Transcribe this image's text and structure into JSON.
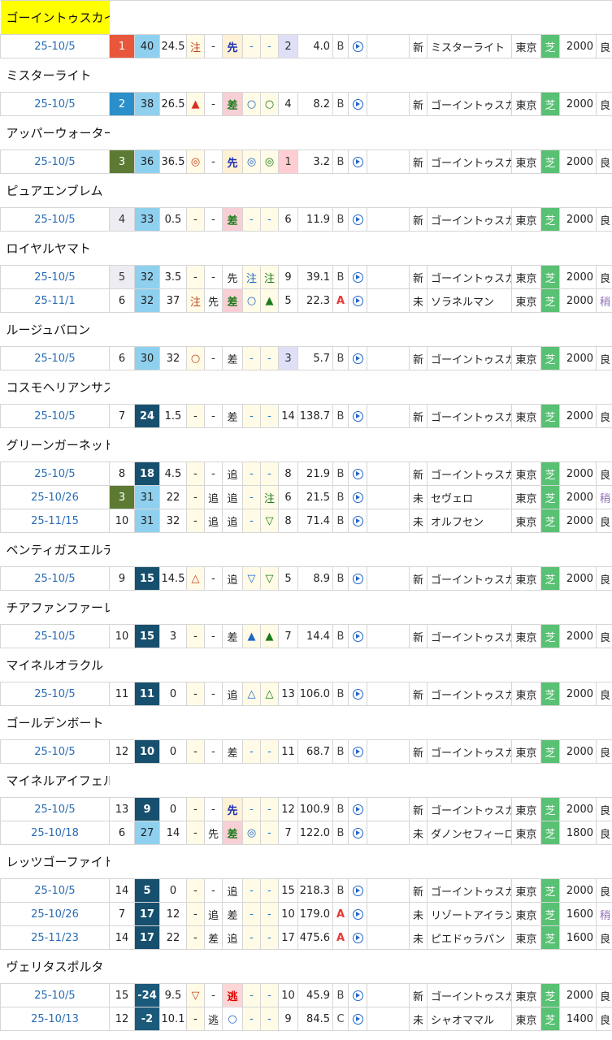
{
  "horses": [
    {
      "name": "ゴーイントゥスカイ",
      "highlight": true,
      "races": [
        {
          "date": "25-10/5",
          "rank": "1",
          "rankClass": "rk1",
          "score": "40",
          "scoreClass": "sc",
          "v1": "24.5",
          "m1": "注",
          "m1c": "org",
          "m2": "-",
          "m2c": "",
          "kyaku": "先",
          "kyakuClass": "sen",
          "m3": "-",
          "m3c": "cbl",
          "m4": "-",
          "m4c": "cbl",
          "ninki": "2",
          "ninkiClass": "ni3",
          "odds": "4.0",
          "grade": "B",
          "gradeClass": "grade-b",
          "cls": "新",
          "opp": "ミスターライト",
          "place": "東京",
          "surface": "芝",
          "dist": "2000",
          "cond": "良",
          "condClass": ""
        }
      ]
    },
    {
      "name": "ミスターライト",
      "highlight": false,
      "races": [
        {
          "date": "25-10/5",
          "rank": "2",
          "rankClass": "rk2",
          "score": "38",
          "scoreClass": "sc",
          "v1": "26.5",
          "m1": "▲",
          "m1c": "red",
          "m2": "-",
          "m2c": "",
          "kyaku": "差",
          "kyakuClass": "sa",
          "m3": "○",
          "m3c": "blu",
          "m4": "○",
          "m4c": "grn",
          "ninki": "4",
          "ninkiClass": "",
          "odds": "8.2",
          "grade": "B",
          "gradeClass": "grade-b",
          "cls": "新",
          "opp": "ゴーイントゥスカイ",
          "place": "東京",
          "surface": "芝",
          "dist": "2000",
          "cond": "良",
          "condClass": ""
        }
      ]
    },
    {
      "name": "アッパーウォーター",
      "highlight": false,
      "races": [
        {
          "date": "25-10/5",
          "rank": "3",
          "rankClass": "rk3",
          "score": "36",
          "scoreClass": "sc",
          "v1": "36.5",
          "m1": "◎",
          "m1c": "org",
          "m2": "-",
          "m2c": "",
          "kyaku": "先",
          "kyakuClass": "sen",
          "m3": "◎",
          "m3c": "blu",
          "m4": "◎",
          "m4c": "grn",
          "ninki": "1",
          "ninkiClass": "ni",
          "odds": "3.2",
          "grade": "B",
          "gradeClass": "grade-b",
          "cls": "新",
          "opp": "ゴーイントゥスカイ",
          "place": "東京",
          "surface": "芝",
          "dist": "2000",
          "cond": "良",
          "condClass": ""
        }
      ]
    },
    {
      "name": "ピュアエンブレム",
      "highlight": false,
      "races": [
        {
          "date": "25-10/5",
          "rank": "4",
          "rankClass": "rkg",
          "score": "33",
          "scoreClass": "sc",
          "v1": "0.5",
          "m1": "-",
          "m1c": "",
          "m2": "-",
          "m2c": "",
          "kyaku": "差",
          "kyakuClass": "sa",
          "m3": "-",
          "m3c": "cbl",
          "m4": "-",
          "m4c": "cbl",
          "ninki": "6",
          "ninkiClass": "",
          "odds": "11.9",
          "grade": "B",
          "gradeClass": "grade-b",
          "cls": "新",
          "opp": "ゴーイントゥスカイ",
          "place": "東京",
          "surface": "芝",
          "dist": "2000",
          "cond": "良",
          "condClass": ""
        }
      ]
    },
    {
      "name": "ロイヤルヤマト",
      "highlight": false,
      "races": [
        {
          "date": "25-10/5",
          "rank": "5",
          "rankClass": "rkg",
          "score": "32",
          "scoreClass": "sc",
          "v1": "3.5",
          "m1": "-",
          "m1c": "",
          "m2": "-",
          "m2c": "",
          "kyaku": "先",
          "kyakuClass": "sen-lt",
          "m3": "注",
          "m3c": "blu",
          "m4": "注",
          "m4c": "grn",
          "ninki": "9",
          "ninkiClass": "",
          "odds": "39.1",
          "grade": "B",
          "gradeClass": "grade-b",
          "cls": "新",
          "opp": "ゴーイントゥスカイ",
          "place": "東京",
          "surface": "芝",
          "dist": "2000",
          "cond": "良",
          "condClass": ""
        },
        {
          "date": "25-11/1",
          "rank": "6",
          "rankClass": "",
          "score": "32",
          "scoreClass": "sc",
          "v1": "37",
          "m1": "注",
          "m1c": "org",
          "m2": "先",
          "m2c": "",
          "kyaku": "差",
          "kyakuClass": "sa",
          "m3": "○",
          "m3c": "blu",
          "m4": "▲",
          "m4c": "grn",
          "ninki": "5",
          "ninkiClass": "",
          "odds": "22.3",
          "grade": "A",
          "gradeClass": "grade-a",
          "cls": "未",
          "opp": "ソラネルマン",
          "place": "東京",
          "surface": "芝",
          "dist": "2000",
          "cond": "稍",
          "condClass": "pur"
        }
      ]
    },
    {
      "name": "ルージュバロン",
      "highlight": false,
      "races": [
        {
          "date": "25-10/5",
          "rank": "6",
          "rankClass": "",
          "score": "30",
          "scoreClass": "sc",
          "v1": "32",
          "m1": "○",
          "m1c": "org",
          "m2": "-",
          "m2c": "",
          "kyaku": "差",
          "kyakuClass": "",
          "m3": "-",
          "m3c": "cbl",
          "m4": "-",
          "m4c": "cbl",
          "ninki": "3",
          "ninkiClass": "ni3",
          "odds": "5.7",
          "grade": "B",
          "gradeClass": "grade-b",
          "cls": "新",
          "opp": "ゴーイントゥスカイ",
          "place": "東京",
          "surface": "芝",
          "dist": "2000",
          "cond": "良",
          "condClass": ""
        }
      ]
    },
    {
      "name": "コスモヘリアンサス",
      "highlight": false,
      "races": [
        {
          "date": "25-10/5",
          "rank": "7",
          "rankClass": "",
          "score": "24",
          "scoreClass": "sc dk",
          "v1": "1.5",
          "m1": "-",
          "m1c": "",
          "m2": "-",
          "m2c": "",
          "kyaku": "差",
          "kyakuClass": "",
          "m3": "-",
          "m3c": "cbl",
          "m4": "-",
          "m4c": "cbl",
          "ninki": "14",
          "ninkiClass": "",
          "odds": "138.7",
          "grade": "B",
          "gradeClass": "grade-b",
          "cls": "新",
          "opp": "ゴーイントゥスカイ",
          "place": "東京",
          "surface": "芝",
          "dist": "2000",
          "cond": "良",
          "condClass": ""
        }
      ]
    },
    {
      "name": "グリーンガーネット",
      "highlight": false,
      "races": [
        {
          "date": "25-10/5",
          "rank": "8",
          "rankClass": "",
          "score": "18",
          "scoreClass": "sc dk",
          "v1": "4.5",
          "m1": "-",
          "m1c": "",
          "m2": "-",
          "m2c": "",
          "kyaku": "追",
          "kyakuClass": "",
          "m3": "-",
          "m3c": "cbl",
          "m4": "-",
          "m4c": "cbl",
          "ninki": "8",
          "ninkiClass": "",
          "odds": "21.9",
          "grade": "B",
          "gradeClass": "grade-b",
          "cls": "新",
          "opp": "ゴーイントゥスカイ",
          "place": "東京",
          "surface": "芝",
          "dist": "2000",
          "cond": "良",
          "condClass": ""
        },
        {
          "date": "25-10/26",
          "rank": "3",
          "rankClass": "rk3",
          "score": "31",
          "scoreClass": "sc",
          "v1": "22",
          "m1": "-",
          "m1c": "",
          "m2": "追",
          "m2c": "",
          "kyaku": "追",
          "kyakuClass": "",
          "m3": "-",
          "m3c": "cbl",
          "m4": "注",
          "m4c": "grn",
          "ninki": "6",
          "ninkiClass": "",
          "odds": "21.5",
          "grade": "B",
          "gradeClass": "grade-b",
          "cls": "未",
          "opp": "セヴェロ",
          "place": "東京",
          "surface": "芝",
          "dist": "2000",
          "cond": "稍",
          "condClass": "pur"
        },
        {
          "date": "25-11/15",
          "rank": "10",
          "rankClass": "",
          "score": "31",
          "scoreClass": "sc",
          "v1": "32",
          "m1": "-",
          "m1c": "",
          "m2": "追",
          "m2c": "",
          "kyaku": "追",
          "kyakuClass": "",
          "m3": "-",
          "m3c": "cbl",
          "m4": "▽",
          "m4c": "grn",
          "ninki": "8",
          "ninkiClass": "",
          "odds": "71.4",
          "grade": "B",
          "gradeClass": "grade-b",
          "cls": "未",
          "opp": "オルフセン",
          "place": "東京",
          "surface": "芝",
          "dist": "2000",
          "cond": "良",
          "condClass": ""
        }
      ]
    },
    {
      "name": "ベンティガスエルテ",
      "highlight": false,
      "races": [
        {
          "date": "25-10/5",
          "rank": "9",
          "rankClass": "",
          "score": "15",
          "scoreClass": "sc dk",
          "v1": "14.5",
          "m1": "△",
          "m1c": "org",
          "m2": "-",
          "m2c": "",
          "kyaku": "追",
          "kyakuClass": "",
          "m3": "▽",
          "m3c": "blu",
          "m4": "▽",
          "m4c": "grn",
          "ninki": "5",
          "ninkiClass": "",
          "odds": "8.9",
          "grade": "B",
          "gradeClass": "grade-b",
          "cls": "新",
          "opp": "ゴーイントゥスカイ",
          "place": "東京",
          "surface": "芝",
          "dist": "2000",
          "cond": "良",
          "condClass": ""
        }
      ]
    },
    {
      "name": "チアファンファーレ",
      "highlight": false,
      "races": [
        {
          "date": "25-10/5",
          "rank": "10",
          "rankClass": "",
          "score": "15",
          "scoreClass": "sc dk",
          "v1": "3",
          "m1": "-",
          "m1c": "",
          "m2": "-",
          "m2c": "",
          "kyaku": "差",
          "kyakuClass": "",
          "m3": "▲",
          "m3c": "blu",
          "m4": "▲",
          "m4c": "grn",
          "ninki": "7",
          "ninkiClass": "",
          "odds": "14.4",
          "grade": "B",
          "gradeClass": "grade-b",
          "cls": "新",
          "opp": "ゴーイントゥスカイ",
          "place": "東京",
          "surface": "芝",
          "dist": "2000",
          "cond": "良",
          "condClass": ""
        }
      ]
    },
    {
      "name": "マイネルオラクル",
      "highlight": false,
      "races": [
        {
          "date": "25-10/5",
          "rank": "11",
          "rankClass": "",
          "score": "11",
          "scoreClass": "sc dk",
          "v1": "0",
          "m1": "-",
          "m1c": "",
          "m2": "-",
          "m2c": "",
          "kyaku": "追",
          "kyakuClass": "",
          "m3": "△",
          "m3c": "blu",
          "m4": "△",
          "m4c": "grn",
          "ninki": "13",
          "ninkiClass": "",
          "odds": "106.0",
          "grade": "B",
          "gradeClass": "grade-b",
          "cls": "新",
          "opp": "ゴーイントゥスカイ",
          "place": "東京",
          "surface": "芝",
          "dist": "2000",
          "cond": "良",
          "condClass": ""
        }
      ]
    },
    {
      "name": "ゴールデンボート",
      "highlight": false,
      "races": [
        {
          "date": "25-10/5",
          "rank": "12",
          "rankClass": "",
          "score": "10",
          "scoreClass": "sc dk",
          "v1": "0",
          "m1": "-",
          "m1c": "",
          "m2": "-",
          "m2c": "",
          "kyaku": "差",
          "kyakuClass": "",
          "m3": "-",
          "m3c": "cbl",
          "m4": "-",
          "m4c": "cbl",
          "ninki": "11",
          "ninkiClass": "",
          "odds": "68.7",
          "grade": "B",
          "gradeClass": "grade-b",
          "cls": "新",
          "opp": "ゴーイントゥスカイ",
          "place": "東京",
          "surface": "芝",
          "dist": "2000",
          "cond": "良",
          "condClass": ""
        }
      ]
    },
    {
      "name": "マイネルアイフェル",
      "highlight": false,
      "races": [
        {
          "date": "25-10/5",
          "rank": "13",
          "rankClass": "",
          "score": "9",
          "scoreClass": "sc dk",
          "v1": "0",
          "m1": "-",
          "m1c": "",
          "m2": "-",
          "m2c": "",
          "kyaku": "先",
          "kyakuClass": "sen",
          "m3": "-",
          "m3c": "cbl",
          "m4": "-",
          "m4c": "cbl",
          "ninki": "12",
          "ninkiClass": "",
          "odds": "100.9",
          "grade": "B",
          "gradeClass": "grade-b",
          "cls": "新",
          "opp": "ゴーイントゥスカイ",
          "place": "東京",
          "surface": "芝",
          "dist": "2000",
          "cond": "良",
          "condClass": ""
        },
        {
          "date": "25-10/18",
          "rank": "6",
          "rankClass": "",
          "score": "27",
          "scoreClass": "sc",
          "v1": "14",
          "m1": "-",
          "m1c": "",
          "m2": "先",
          "m2c": "",
          "kyaku": "差",
          "kyakuClass": "sa",
          "m3": "◎",
          "m3c": "blu",
          "m4": "-",
          "m4c": "cbl",
          "ninki": "7",
          "ninkiClass": "",
          "odds": "122.0",
          "grade": "B",
          "gradeClass": "grade-b",
          "cls": "未",
          "opp": "ダノンセフィーロ",
          "place": "東京",
          "surface": "芝",
          "dist": "1800",
          "cond": "良",
          "condClass": ""
        }
      ]
    },
    {
      "name": "レッツゴーファイト",
      "highlight": false,
      "races": [
        {
          "date": "25-10/5",
          "rank": "14",
          "rankClass": "",
          "score": "5",
          "scoreClass": "sc dk",
          "v1": "0",
          "m1": "-",
          "m1c": "",
          "m2": "-",
          "m2c": "",
          "kyaku": "追",
          "kyakuClass": "",
          "m3": "-",
          "m3c": "cbl",
          "m4": "-",
          "m4c": "cbl",
          "ninki": "15",
          "ninkiClass": "",
          "odds": "218.3",
          "grade": "B",
          "gradeClass": "grade-b",
          "cls": "新",
          "opp": "ゴーイントゥスカイ",
          "place": "東京",
          "surface": "芝",
          "dist": "2000",
          "cond": "良",
          "condClass": ""
        },
        {
          "date": "25-10/26",
          "rank": "7",
          "rankClass": "",
          "score": "17",
          "scoreClass": "sc dk",
          "v1": "12",
          "m1": "-",
          "m1c": "",
          "m2": "追",
          "m2c": "",
          "kyaku": "差",
          "kyakuClass": "",
          "m3": "-",
          "m3c": "cbl",
          "m4": "-",
          "m4c": "cbl",
          "ninki": "10",
          "ninkiClass": "",
          "odds": "179.0",
          "grade": "A",
          "gradeClass": "grade-a",
          "cls": "未",
          "opp": "リゾートアイランド",
          "place": "東京",
          "surface": "芝",
          "dist": "1600",
          "cond": "稍",
          "condClass": "pur"
        },
        {
          "date": "25-11/23",
          "rank": "14",
          "rankClass": "",
          "score": "17",
          "scoreClass": "sc dk",
          "v1": "22",
          "m1": "-",
          "m1c": "",
          "m2": "差",
          "m2c": "",
          "kyaku": "追",
          "kyakuClass": "",
          "m3": "-",
          "m3c": "cbl",
          "m4": "-",
          "m4c": "cbl",
          "ninki": "17",
          "ninkiClass": "",
          "odds": "475.6",
          "grade": "A",
          "gradeClass": "grade-a",
          "cls": "未",
          "opp": "ピエドゥラパン",
          "place": "東京",
          "surface": "芝",
          "dist": "1600",
          "cond": "良",
          "condClass": ""
        }
      ]
    },
    {
      "name": "ヴェリタスポルタ",
      "highlight": false,
      "races": [
        {
          "date": "25-10/5",
          "rank": "15",
          "rankClass": "",
          "score": "-24",
          "scoreClass": "sc neg",
          "v1": "9.5",
          "m1": "▽",
          "m1c": "org",
          "m2": "-",
          "m2c": "",
          "kyaku": "逃",
          "kyakuClass": "nige",
          "m3": "-",
          "m3c": "cbl",
          "m4": "-",
          "m4c": "cbl",
          "ninki": "10",
          "ninkiClass": "",
          "odds": "45.9",
          "grade": "B",
          "gradeClass": "grade-b",
          "cls": "新",
          "opp": "ゴーイントゥスカイ",
          "place": "東京",
          "surface": "芝",
          "dist": "2000",
          "cond": "良",
          "condClass": ""
        },
        {
          "date": "25-10/13",
          "rank": "12",
          "rankClass": "",
          "score": "-2",
          "scoreClass": "sc neg",
          "v1": "10.1",
          "m1": "-",
          "m1c": "",
          "m2": "逃",
          "m2c": "",
          "kyaku": "○",
          "kyakuClass": "blu",
          "m3": "-",
          "m3c": "cbl",
          "m4": "-",
          "m4c": "cbl",
          "ninki": "9",
          "ninkiClass": "",
          "odds": "84.5",
          "grade": "C",
          "gradeClass": "grade-b",
          "cls": "未",
          "opp": "シャオママル",
          "place": "東京",
          "surface": "芝",
          "dist": "1400",
          "cond": "良",
          "condClass": ""
        }
      ]
    }
  ]
}
